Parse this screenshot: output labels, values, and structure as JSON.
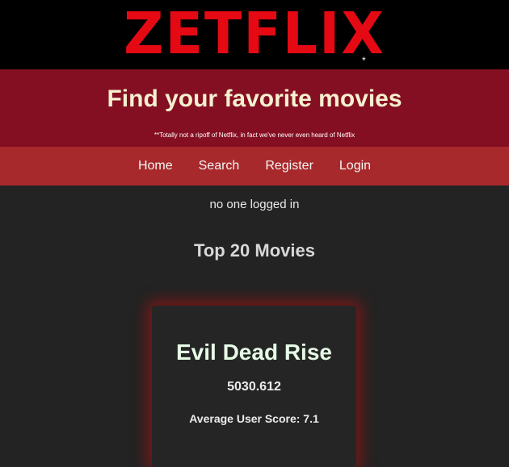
{
  "brand": {
    "logo": "ZETFLIX",
    "logo_mark": "*"
  },
  "hero": {
    "title": "Find your favorite movies",
    "disclaimer": "**Totally not a ripoff of Netflix, in fact we've never even heard of Netflix"
  },
  "nav": [
    {
      "label": "Home"
    },
    {
      "label": "Search"
    },
    {
      "label": "Register"
    },
    {
      "label": "Login"
    }
  ],
  "status": {
    "login_text": "no one logged in"
  },
  "section": {
    "title": "Top 20 Movies"
  },
  "movies": [
    {
      "title": "Evil Dead Rise",
      "popularity": "5030.612",
      "score_label": "Average User Score: 7.1"
    }
  ],
  "colors": {
    "logo": "#e50914",
    "hero_bg": "#850f22",
    "nav_bg": "#a8292b",
    "page_bg": "#232323"
  }
}
